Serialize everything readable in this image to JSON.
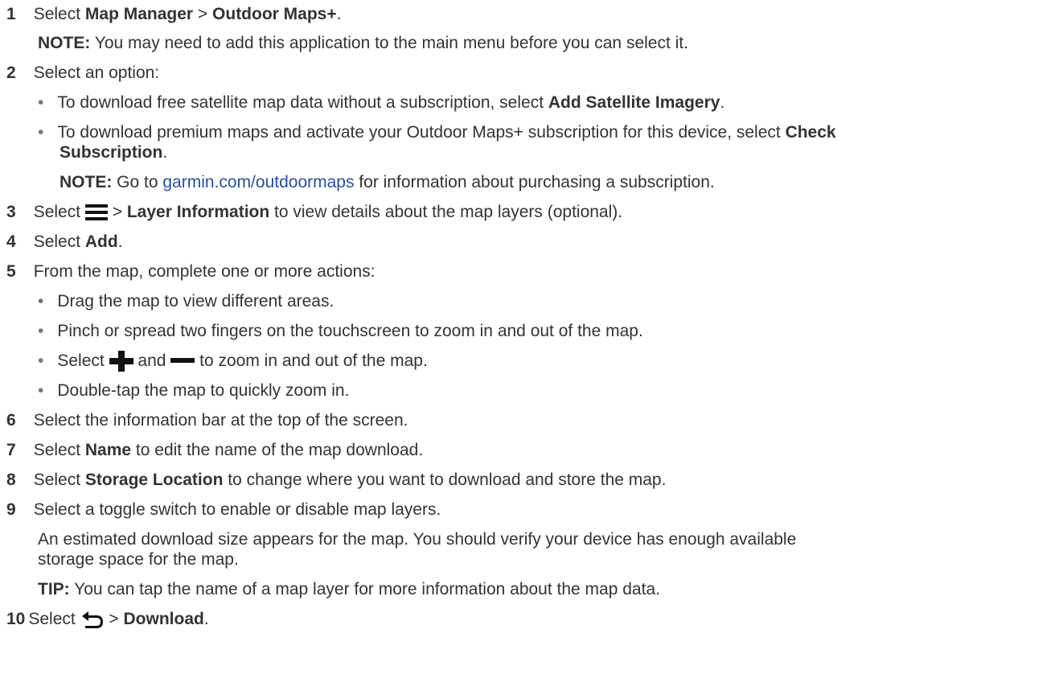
{
  "steps": [
    {
      "num": "1",
      "pre": "Select ",
      "b1": "Map Manager",
      "mid": " > ",
      "b2": "Outdoor Maps+",
      "post": "."
    },
    {
      "note_label": "NOTE:",
      "note_text": " You may need to add this application to the main menu before you can select it."
    },
    {
      "num": "2",
      "text": "Select an option:"
    },
    {
      "bullet": "•",
      "pre": "To download free satellite map data without a subscription, select ",
      "b1": "Add Satellite Imagery",
      "post": "."
    },
    {
      "bullet": "•",
      "pre": "To download premium maps and activate your Outdoor Maps+ subscription for this device, select ",
      "b1": "Check",
      "b1_cont": "Subscription",
      "post": "."
    },
    {
      "note_label": "NOTE:",
      "pre": " Go to ",
      "link": "garmin.com/outdoormaps",
      "post": " for information about purchasing a subscription."
    },
    {
      "num": "3",
      "pre": "Select ",
      "mid": " > ",
      "b1": "Layer Information",
      "post": " to view details about the map layers (optional)."
    },
    {
      "num": "4",
      "pre": "Select ",
      "b1": "Add",
      "post": "."
    },
    {
      "num": "5",
      "text": "From the map, complete one or more actions:"
    },
    {
      "bullet": "•",
      "text": "Drag the map to view different areas."
    },
    {
      "bullet": "•",
      "text": "Pinch or spread two fingers on the touchscreen to zoom in and out of the map."
    },
    {
      "bullet": "•",
      "pre": "Select ",
      "mid": " and ",
      "post": " to zoom in and out of the map."
    },
    {
      "bullet": "•",
      "text": "Double-tap the map to quickly zoom in."
    },
    {
      "num": "6",
      "text": "Select the information bar at the top of the screen."
    },
    {
      "num": "7",
      "pre": "Select ",
      "b1": "Name",
      "post": " to edit the name of the map download."
    },
    {
      "num": "8",
      "pre": "Select ",
      "b1": "Storage Location",
      "post": " to change where you want to download and store the map."
    },
    {
      "num": "9",
      "text": "Select a toggle switch to enable or disable map layers."
    },
    {
      "text": "An estimated download size appears for the map. You should verify your device has enough available",
      "text_cont": "storage space for the map."
    },
    {
      "note_label": "TIP:",
      "note_text": " You can tap the name of a map layer for more information about the map data."
    },
    {
      "num": "10",
      "pre": "Select ",
      "mid": " > ",
      "b1": "Download",
      "post": "."
    }
  ],
  "icons": {
    "menu": "menu-icon",
    "plus": "plus-icon",
    "minus": "minus-icon",
    "back": "back-icon"
  }
}
